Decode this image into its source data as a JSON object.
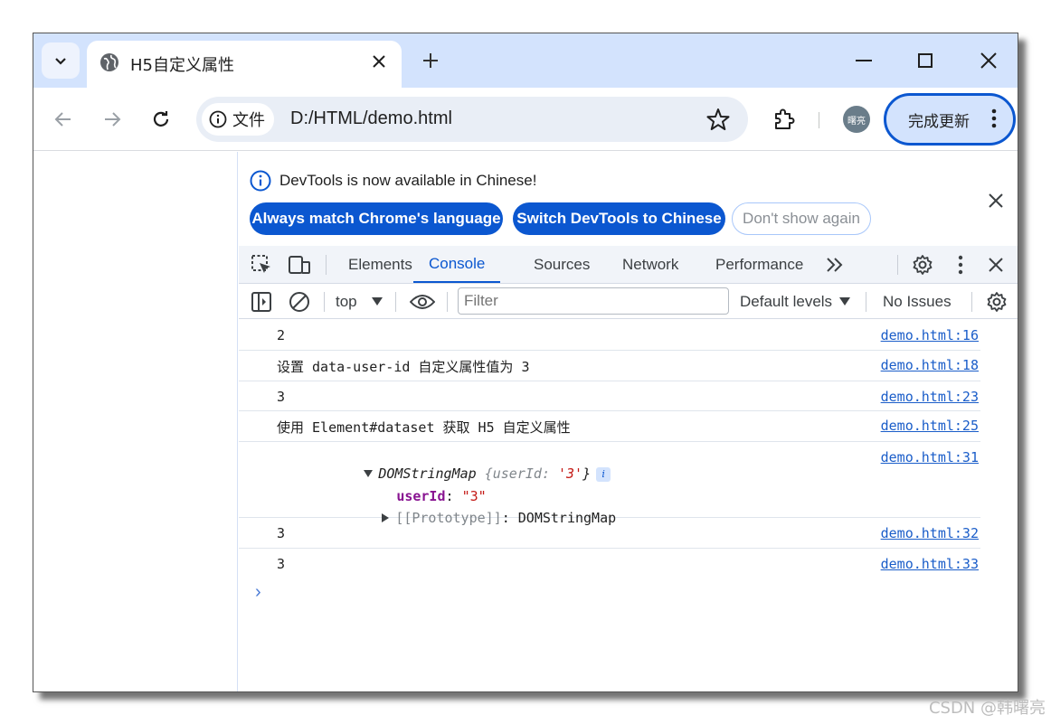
{
  "browser": {
    "tab_title": "H5自定义属性",
    "chip_label": "文件",
    "url": "D:/HTML/demo.html",
    "avatar_text": "曙亮",
    "update_label": "完成更新"
  },
  "infobar": {
    "message": "DevTools is now available in Chinese!",
    "buttons": [
      "Always match Chrome's language",
      "Switch DevTools to Chinese",
      "Don't show again"
    ]
  },
  "devtools": {
    "tabs": [
      "Elements",
      "Console",
      "Sources",
      "Network",
      "Performance"
    ],
    "active_tab": "Console",
    "more_tabs": ">>"
  },
  "console_bar": {
    "context": "top",
    "filter_placeholder": "Filter",
    "levels": "Default levels",
    "issues": "No Issues"
  },
  "logs": [
    {
      "text": "2",
      "source": "demo.html:16"
    },
    {
      "text": "设置 data-user-id 自定义属性值为 3",
      "source": "demo.html:18"
    },
    {
      "text": "3",
      "source": "demo.html:23"
    },
    {
      "text": "使用 Element#dataset 获取 H5 自定义属性",
      "source": "demo.html:25"
    },
    {
      "text": "",
      "source": "demo.html:31"
    },
    {
      "text": "3",
      "source": "demo.html:32"
    },
    {
      "text": "3",
      "source": "demo.html:33"
    }
  ],
  "object_log": {
    "class_name": "DOMStringMap",
    "preview_open": " {",
    "preview_key": "userId",
    "preview_colon": ": ",
    "preview_value": "'3'",
    "preview_close": "}",
    "badge": "i",
    "prop_key": "userId",
    "prop_colon": ": ",
    "prop_value": "\"3\"",
    "proto_key": "[[Prototype]]",
    "proto_colon": ": ",
    "proto_value": "DOMStringMap"
  },
  "prompt_symbol": "›",
  "watermark": "CSDN @韩曙亮",
  "colors": {
    "accent": "#0b57d0",
    "link": "#1a5dc9",
    "tabstrip": "#d3e3fd",
    "key": "#881391",
    "string": "#c41a16"
  }
}
